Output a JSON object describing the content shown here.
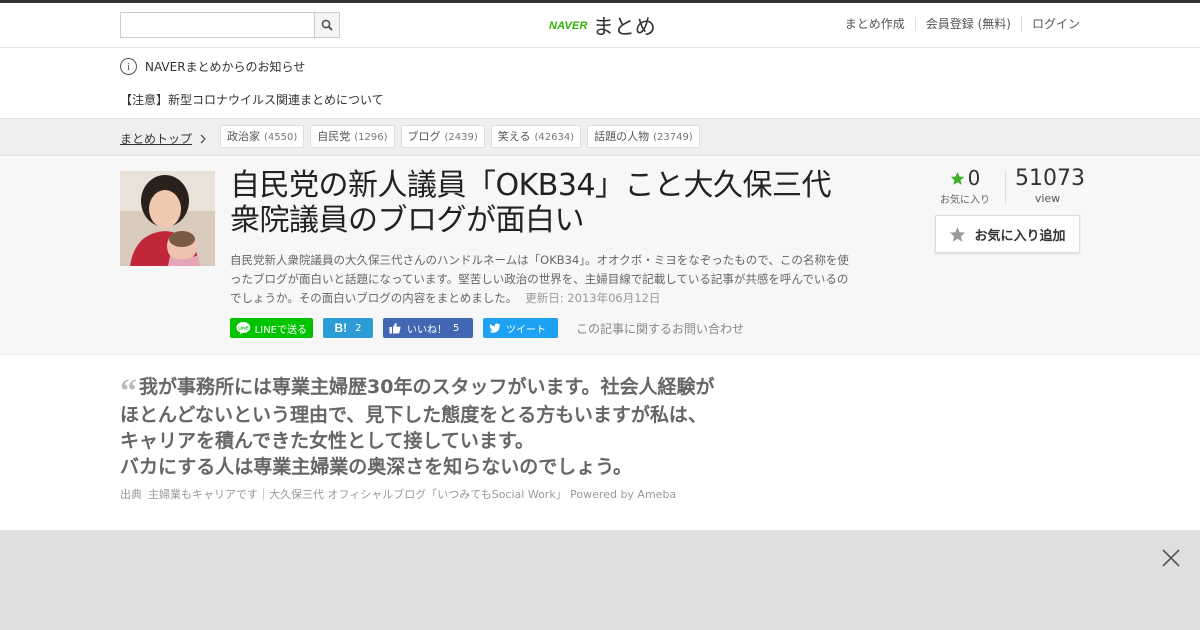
{
  "header": {
    "search": {
      "placeholder": "",
      "value": ""
    },
    "logo": {
      "brand": "NAVER",
      "name": "まとめ"
    },
    "nav": [
      "まとめ作成",
      "会員登録 (無料)",
      "ログイン"
    ]
  },
  "notice": {
    "title": "NAVERまとめからのお知らせ",
    "item": "【注意】新型コロナウイルス関連まとめについて"
  },
  "breadcrumb": {
    "label": "まとめトップ"
  },
  "tags": [
    {
      "label": "政治家",
      "count": "(4550)"
    },
    {
      "label": "自民党",
      "count": "(1296)"
    },
    {
      "label": "ブログ",
      "count": "(2439)"
    },
    {
      "label": "笑える",
      "count": "(42634)"
    },
    {
      "label": "話題の人物",
      "count": "(23749)"
    }
  ],
  "article": {
    "title": "自民党の新人議員「OKB34」こと大久保三代衆院議員のブログが面白い",
    "description": "自民党新人衆院議員の大久保三代さんのハンドルネームは「OKB34」。オオクボ・ミヨをなぞったもので、この名称を使ったブログが面白いと話題になっています。堅苦しい政治の世界を、主婦目線で記載している記事が共感を呼んでいるのでしょうか。その面白いブログの内容をまとめました。",
    "updated": "更新日: 2013年06月12日",
    "favorites": {
      "count": "0",
      "label": "お気に入り"
    },
    "views": {
      "count": "51073",
      "label": "view"
    },
    "fav_button": "お気に入り追加"
  },
  "share": {
    "line": "LINEで送る",
    "hatena_count": "2",
    "facebook": "いいね！",
    "facebook_count": "5",
    "twitter": "ツイート",
    "inquiry": "この記事に関するお問い合わせ"
  },
  "quote": {
    "lines": [
      "我が事務所には専業主婦歴30年のスタッフがいます。社会人経験が",
      "ほとんどないという理由で、見下した態度をとる方もいますが私は、",
      "キャリアを積んできた女性として接しています。",
      "バカにする人は専業主婦業の奥深さを知らないのでしょう。"
    ],
    "source_label": "出典",
    "source_title": "主婦業もキャリアです｜大久保三代 オフィシャルブログ「いつみてもSocial Work」 Powered by Ameba"
  },
  "colors": {
    "naver_green": "#2db400",
    "line_green": "#00c300",
    "hatena_blue": "#2c9cd6",
    "facebook_blue": "#4267b2",
    "twitter_blue": "#1da1f2",
    "star_green": "#3fae29"
  },
  "icons": [
    "search-icon",
    "info-icon",
    "chevron-right-icon",
    "star-icon",
    "close-icon"
  ]
}
